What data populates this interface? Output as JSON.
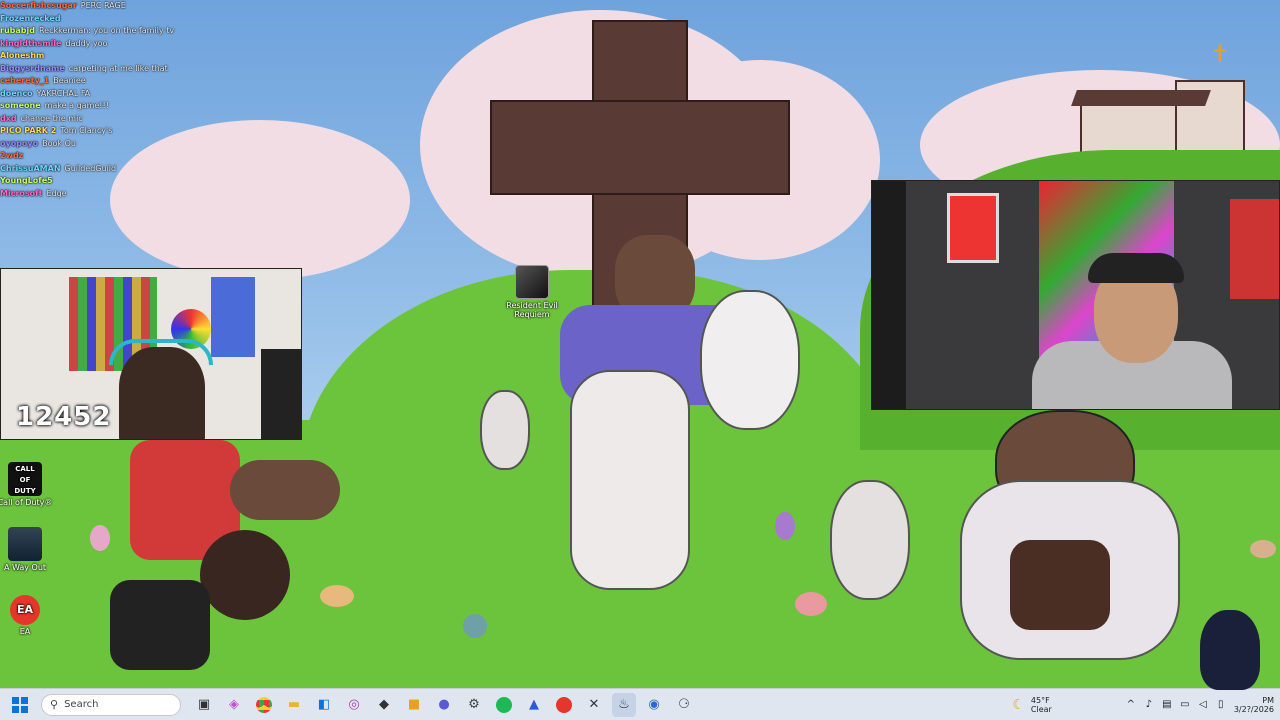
{
  "stream": {
    "viewer_count": "12452"
  },
  "chat": [
    {
      "user": "Soccerfishcsugar",
      "msg": "PERC RAGE"
    },
    {
      "user": "Frozenrecked",
      "msg": ""
    },
    {
      "user": "rubabjd",
      "msg": "Reckkerman: you on the family tv"
    },
    {
      "user": "kingldthsmile",
      "msg": "daddy yoo"
    },
    {
      "user": "Aloneshm",
      "msg": ""
    },
    {
      "user": "Biggysrdname",
      "msg": "carpeting at me like that"
    },
    {
      "user": "ceherety_1",
      "msg": "Beaniee"
    },
    {
      "user": "doenco",
      "msg": "YAKRCHAL FA"
    },
    {
      "user": "someone",
      "msg": "make a game!!!"
    },
    {
      "user": "dxd",
      "msg": "change the mic"
    },
    {
      "user": "PICO PARK 2",
      "msg": "Tom Clancy's"
    },
    {
      "user": "oyopoyo",
      "msg": "Book Ou"
    },
    {
      "user": "2wdz",
      "msg": ""
    },
    {
      "user": "ChrissuAMAN",
      "msg": "GuildedGuild"
    },
    {
      "user": "YoungLofe5",
      "msg": ""
    },
    {
      "user": "Microsoft",
      "msg": "Edge"
    }
  ],
  "desktop_icons": [
    {
      "label": "Resident Evil Requiem"
    },
    {
      "label": "Call of Duty®"
    },
    {
      "label": "A Way Out"
    },
    {
      "label": "EA"
    }
  ],
  "taskbar": {
    "search_placeholder": "Search",
    "weather_temp": "45°F",
    "weather_cond": "Clear",
    "time": "PM",
    "date": "3/2?/2026"
  },
  "colors": {
    "sky": "#7fb0e0",
    "grass": "#6cc43c",
    "cross": "#5a3a34",
    "taskbar": "#dfe6ef"
  },
  "icons": [
    "windows-start-icon",
    "search-icon",
    "task-view-icon",
    "chrome-icon",
    "file-explorer-icon",
    "store-icon",
    "spotify-icon",
    "steam-icon",
    "settings-icon"
  ]
}
